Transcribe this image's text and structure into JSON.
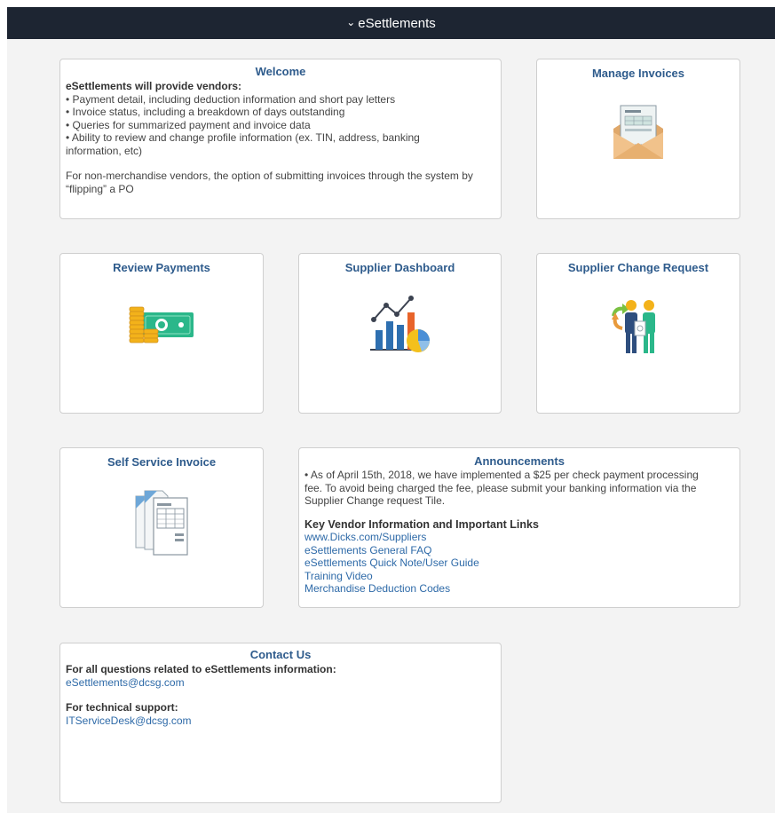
{
  "header": {
    "chevron": "⌄",
    "title": "eSettlements"
  },
  "tiles": {
    "welcome": {
      "title": "Welcome",
      "intro": "eSettlements will provide vendors:",
      "bullets": [
        "• Payment detail, including deduction information and short pay letters",
        "• Invoice status, including a breakdown of days outstanding",
        "• Queries for summarized payment and invoice data",
        "• Ability to review and change profile information (ex. TIN, address, banking information, etc)"
      ],
      "note": "For non-merchandise vendors, the option of submitting invoices through the system by “flipping” a PO"
    },
    "manage_invoices": {
      "title": "Manage Invoices",
      "icon": "invoice-envelope-icon"
    },
    "review_payments": {
      "title": "Review Payments",
      "icon": "cash-coins-icon"
    },
    "supplier_dashboard": {
      "title": "Supplier Dashboard",
      "icon": "analytics-chart-icon"
    },
    "supplier_change_request": {
      "title": "Supplier Change Request",
      "icon": "people-exchange-icon"
    },
    "self_service_invoice": {
      "title": "Self Service Invoice",
      "icon": "document-stack-icon"
    },
    "announcements": {
      "title": "Announcements",
      "text": "• As of April 15th, 2018, we have implemented a $25 per check payment processing fee. To avoid being charged the fee, please submit your banking information via the Supplier Change request Tile.",
      "links_heading": "Key Vendor Information and Important Links",
      "links": [
        "www.Dicks.com/Suppliers",
        "eSettlements General FAQ",
        "eSettlements Quick Note/User Guide",
        "Training Video",
        "Merchandise Deduction Codes"
      ]
    },
    "contact": {
      "title": "Contact Us",
      "q1": "For all questions related to eSettlements information:",
      "email1": "eSettlements@dcsg.com",
      "q2": "For technical support:",
      "email2": "ITServiceDesk@dcsg.com"
    }
  },
  "colors": {
    "topbar": "#1d2532",
    "title": "#2e5b8c",
    "link": "#2e6aa8",
    "background": "#f3f3f3"
  }
}
